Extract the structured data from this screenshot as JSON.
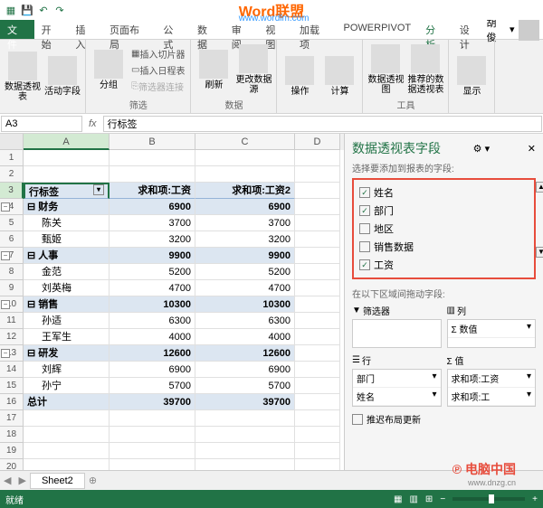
{
  "title": {
    "watermark": "Word联盟",
    "sub": "www.wordlm.com"
  },
  "tabs": [
    "文件",
    "开始",
    "插入",
    "页面布局",
    "公式",
    "数据",
    "审阅",
    "视图",
    "加载项",
    "POWERPIVOT",
    "分析",
    "设计"
  ],
  "user": "胡俊",
  "ribbon": {
    "grp1": {
      "btn1": "数据透视表",
      "btn2": "活动字段",
      "label": ""
    },
    "grp2": {
      "btn": "分组",
      "a": "插入切片器",
      "b": "插入日程表",
      "c": "筛选器连接",
      "label": "筛选"
    },
    "grp3": {
      "a": "刷新",
      "b": "更改数据源",
      "label": "数据"
    },
    "grp4": {
      "a": "操作",
      "b": "计算"
    },
    "grp5": {
      "a": "数据透视图",
      "b": "推荐的数据透视表",
      "label": "工具"
    },
    "grp6": {
      "a": "显示"
    }
  },
  "namebox": "A3",
  "formula": "行标签",
  "cols": [
    "A",
    "B",
    "C",
    "D"
  ],
  "pivot": {
    "header": {
      "a": "行标签",
      "b": "求和项:工资",
      "c": "求和项:工资2"
    },
    "rows": [
      {
        "r": 4,
        "a": "财务",
        "b": 6900,
        "c": 6900,
        "sub": true,
        "exp": true
      },
      {
        "r": 5,
        "a": "陈关",
        "b": 3700,
        "c": 3700
      },
      {
        "r": 6,
        "a": "甄姬",
        "b": 3200,
        "c": 3200
      },
      {
        "r": 7,
        "a": "人事",
        "b": 9900,
        "c": 9900,
        "sub": true,
        "exp": true
      },
      {
        "r": 8,
        "a": "金范",
        "b": 5200,
        "c": 5200
      },
      {
        "r": 9,
        "a": "刘英梅",
        "b": 4700,
        "c": 4700
      },
      {
        "r": 10,
        "a": "销售",
        "b": 10300,
        "c": 10300,
        "sub": true,
        "exp": true
      },
      {
        "r": 11,
        "a": "孙适",
        "b": 6300,
        "c": 6300
      },
      {
        "r": 12,
        "a": "王军生",
        "b": 4000,
        "c": 4000
      },
      {
        "r": 13,
        "a": "研发",
        "b": 12600,
        "c": 12600,
        "sub": true,
        "exp": true
      },
      {
        "r": 14,
        "a": "刘辉",
        "b": 6900,
        "c": 6900
      },
      {
        "r": 15,
        "a": "孙宁",
        "b": 5700,
        "c": 5700
      },
      {
        "r": 16,
        "a": "总计",
        "b": 39700,
        "c": 39700,
        "total": true
      }
    ]
  },
  "fieldPane": {
    "title": "数据透视表字段",
    "sub": "选择要添加到报表的字段:",
    "fields": [
      {
        "name": "姓名",
        "checked": true
      },
      {
        "name": "部门",
        "checked": true
      },
      {
        "name": "地区",
        "checked": false
      },
      {
        "name": "销售数据",
        "checked": false
      },
      {
        "name": "工资",
        "checked": true
      }
    ],
    "areaLabel": "在以下区域间拖动字段:",
    "areas": {
      "filter": "筛选器",
      "cols": "列",
      "rows": "行",
      "vals": "Σ 值",
      "colItems": [
        "Σ 数值"
      ],
      "rowItems": [
        "部门",
        "姓名"
      ],
      "valItems": [
        "求和项:工资",
        "求和项:工"
      ]
    },
    "defer": "推迟布局更新"
  },
  "sheet": "Sheet2",
  "status": "就绪",
  "brand": {
    "name": "电脑中国",
    "url": "www.dnzg.cn"
  }
}
